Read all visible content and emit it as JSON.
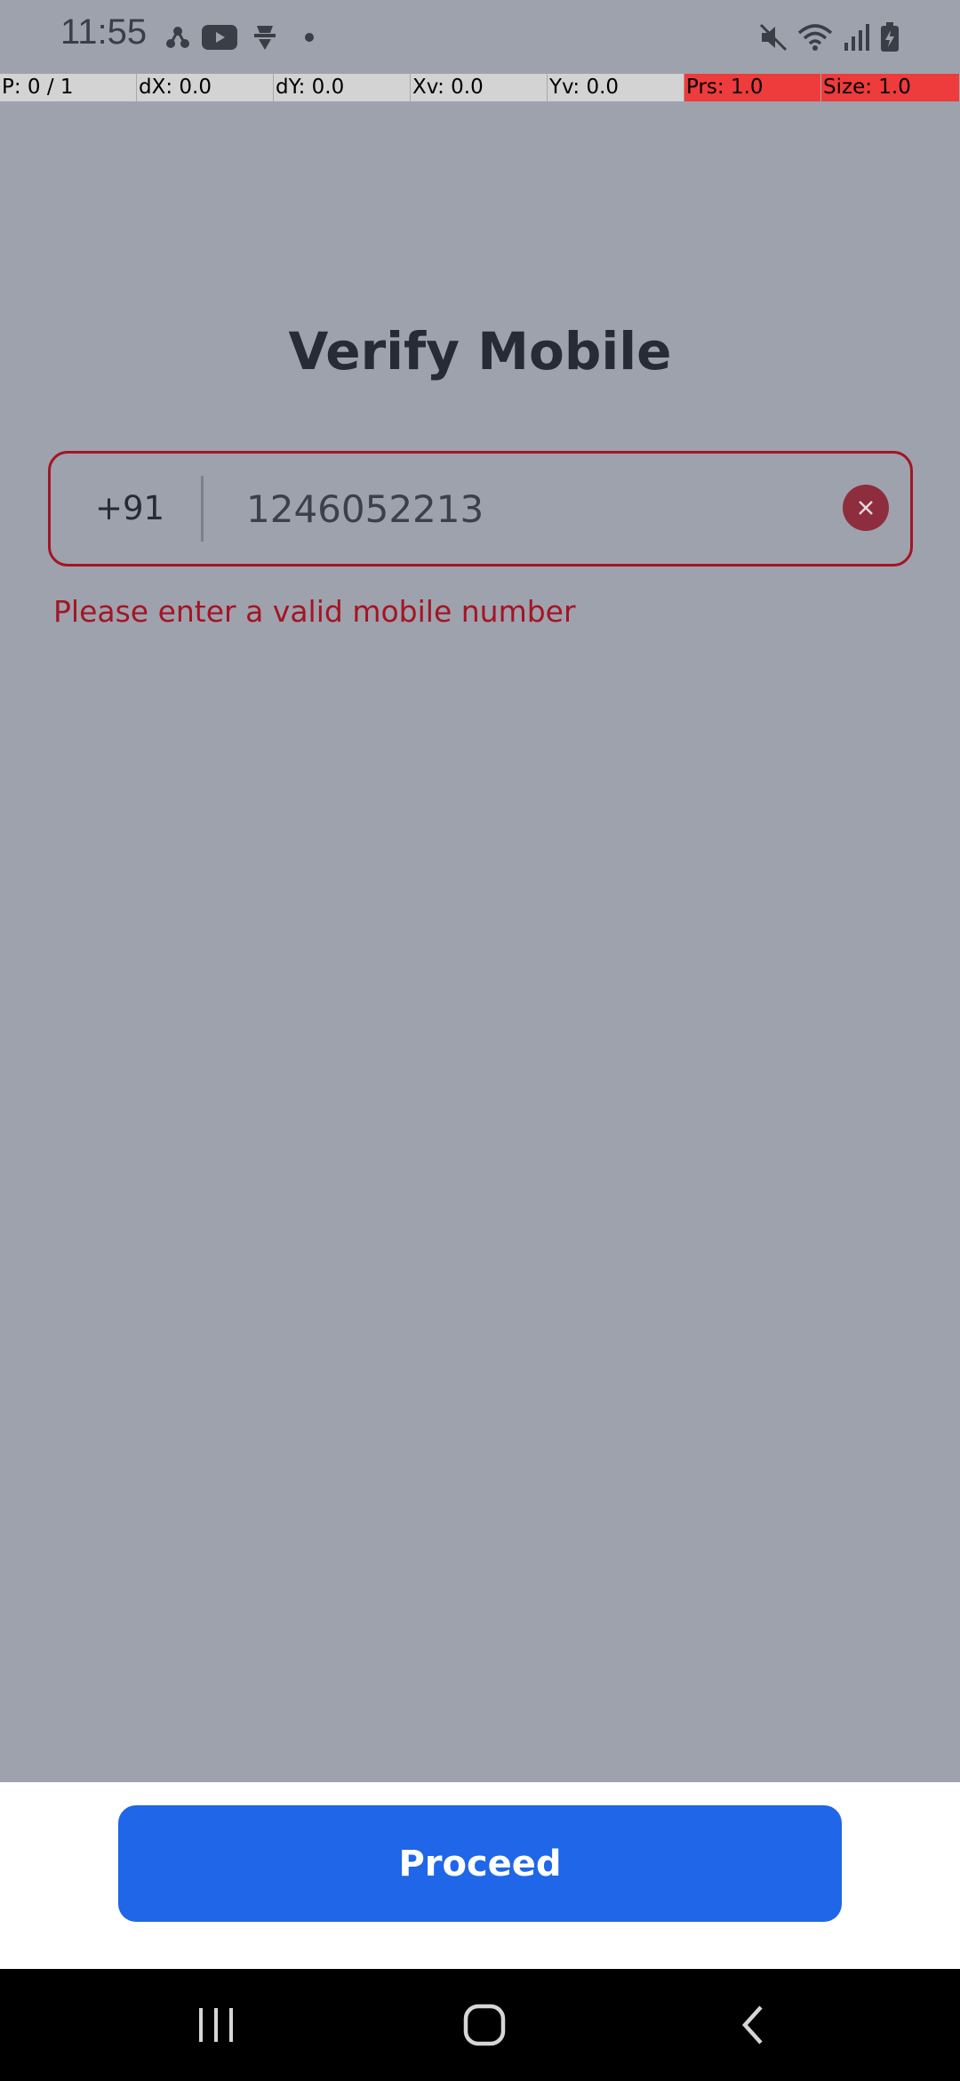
{
  "status_bar": {
    "time": "11:55",
    "left_icons": [
      "nodes-icon",
      "youtube-icon",
      "incognito-icon",
      "dot-icon"
    ],
    "right_icons": [
      "mute-icon",
      "wifi-icon",
      "signal-icon",
      "battery-icon"
    ]
  },
  "pointer_bar": {
    "cells": [
      {
        "text": "P: 0 / 1",
        "alert": false
      },
      {
        "text": "dX: 0.0",
        "alert": false
      },
      {
        "text": "dY: 0.0",
        "alert": false
      },
      {
        "text": "Xv: 0.0",
        "alert": false
      },
      {
        "text": "Yv: 0.0",
        "alert": false
      },
      {
        "text": "Prs: 1.0",
        "alert": true
      },
      {
        "text": "Size: 1.0",
        "alert": true
      }
    ]
  },
  "page": {
    "title": "Verify Mobile"
  },
  "phone_field": {
    "country_code": "+91",
    "value": "1246052213",
    "clear_icon": "close-icon"
  },
  "error": {
    "message": "Please enter a valid mobile number"
  },
  "actions": {
    "proceed_label": "Proceed"
  },
  "colors": {
    "background": "#9ea2ad",
    "error": "#a31524",
    "primary": "#1f66e8"
  }
}
